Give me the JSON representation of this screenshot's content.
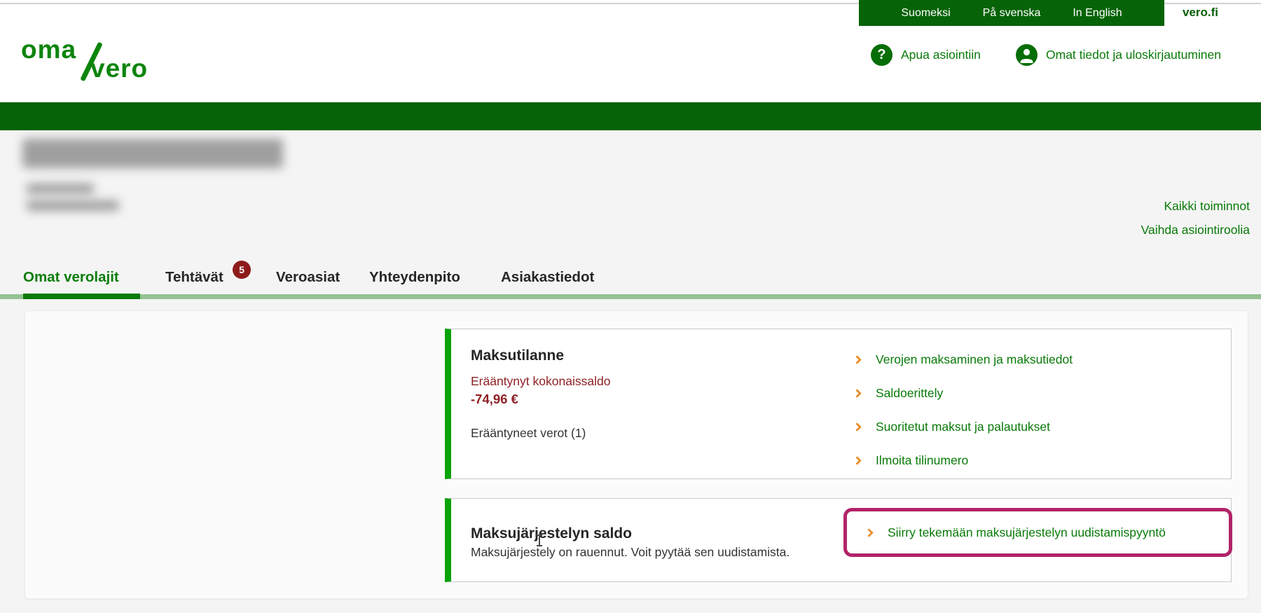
{
  "top_bar": {
    "languages": [
      {
        "label": "Suomeksi"
      },
      {
        "label": "På svenska"
      },
      {
        "label": "In English"
      }
    ],
    "site_link": "vero.fi"
  },
  "header": {
    "logo_top": "oma",
    "logo_bottom": "vero",
    "help_link": "Apua asiointiin",
    "profile_link": "Omat tiedot ja uloskirjautuminen"
  },
  "user": {
    "name_redacted": "blurred",
    "detail_lines_redacted": 2
  },
  "quick_links": {
    "all_actions": "Kaikki toiminnot",
    "switch_role": "Vaihda asiointiroolia"
  },
  "tabs": {
    "items": [
      {
        "label": "Omat verolajit",
        "active": true
      },
      {
        "label": "Tehtävät",
        "badge": "5"
      },
      {
        "label": "Veroasiat"
      },
      {
        "label": "Yhteydenpito"
      },
      {
        "label": "Asiakastiedot"
      }
    ]
  },
  "payment_status_card": {
    "title": "Maksutilanne",
    "overdue_label": "Erääntynyt kokonaissaldo",
    "overdue_amount": "-74,96 €",
    "overdue_taxes": "Erääntyneet verot (1)",
    "links": [
      {
        "label": "Verojen maksaminen ja maksutiedot"
      },
      {
        "label": "Saldoerittely"
      },
      {
        "label": "Suoritetut maksut ja palautukset"
      },
      {
        "label": "Ilmoita tilinumero"
      }
    ]
  },
  "payment_arrangement_card": {
    "title": "Maksujärjestelyn saldo",
    "description": "Maksujärjestely on rauennut. Voit pyytää sen uudistamista.",
    "highlighted_link": "Siirry tekemään maksujärjestelyn uudistamispyyntö"
  },
  "icons": {
    "help": "question-mark-icon",
    "profile": "person-icon",
    "link_arrow": "chevron-right-icon"
  },
  "colors": {
    "brand_green_dark": "#076307",
    "brand_green_link": "#097a09",
    "card_border_green": "#09a309",
    "tab_underline_light": "#94c294",
    "alert_red_text": "#8e2125",
    "badge_red": "#8e1b1b",
    "chevron_orange": "#ea8d28",
    "annotation_magenta": "#b22368",
    "page_gray": "#f4f4f4"
  }
}
